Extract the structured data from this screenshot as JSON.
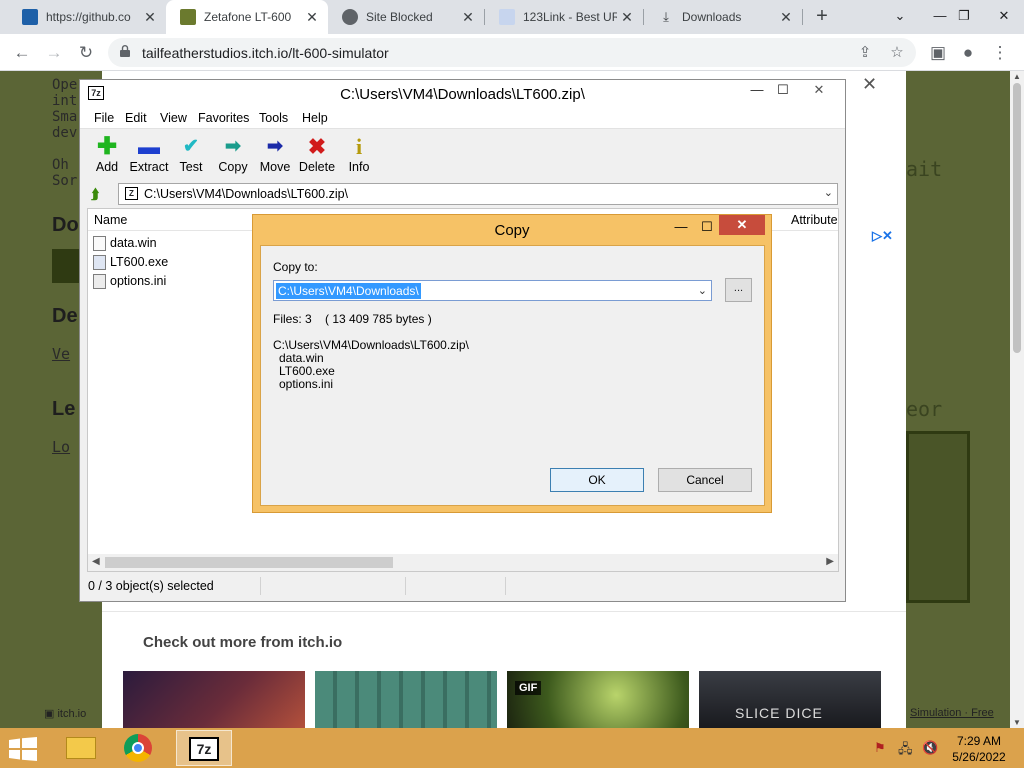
{
  "browser": {
    "tabs": [
      {
        "title": "https://github.co",
        "icon": "github-icon",
        "active": false
      },
      {
        "title": "Zetafone LT-600",
        "icon": "itch-game-icon",
        "active": true
      },
      {
        "title": "Site Blocked",
        "icon": "globe-icon",
        "active": false
      },
      {
        "title": "123Link - Best UR",
        "icon": "link-icon",
        "active": false
      },
      {
        "title": "Downloads",
        "icon": "download-icon",
        "active": false
      }
    ],
    "address": "tailfeatherstudios.itch.io/lt-600-simulator"
  },
  "page": {
    "more_title": "Check out more from itch.io",
    "gif_badge": "GIF",
    "slice_dice": "SLICE DICE",
    "footer_right": "Simulation · Free"
  },
  "zip": {
    "title": "C:\\Users\\VM4\\Downloads\\LT600.zip\\",
    "menu": [
      "File",
      "Edit",
      "View",
      "Favorites",
      "Tools",
      "Help"
    ],
    "tools": [
      {
        "label": "Add",
        "icon": "add-plus-icon",
        "color": "#1fb51f"
      },
      {
        "label": "Extract",
        "icon": "extract-minus-icon",
        "color": "#1d3fcf"
      },
      {
        "label": "Test",
        "icon": "test-check-icon",
        "color": "#21b9c4"
      },
      {
        "label": "Copy",
        "icon": "copy-arrow-icon",
        "color": "#1a9c8c"
      },
      {
        "label": "Move",
        "icon": "move-arrow-icon",
        "color": "#1b2aa8"
      },
      {
        "label": "Delete",
        "icon": "delete-x-icon",
        "color": "#d11b1b"
      },
      {
        "label": "Info",
        "icon": "info-icon",
        "color": "#b59a0c"
      }
    ],
    "address": "C:\\Users\\VM4\\Downloads\\LT600.zip\\",
    "columns": {
      "name": "Name",
      "attributes": "Attribute"
    },
    "files": [
      "data.win",
      "LT600.exe",
      "options.ini"
    ],
    "status": "0 / 3 object(s) selected"
  },
  "copy_dialog": {
    "title": "Copy",
    "copy_to_label": "Copy to:",
    "destination": "C:\\Users\\VM4\\Downloads\\",
    "browse_label": "...",
    "files_info": "Files: 3    ( 13 409 785 bytes )",
    "source_path": "C:\\Users\\VM4\\Downloads\\LT600.zip\\",
    "source_files": [
      "data.win",
      "LT600.exe",
      "options.ini"
    ],
    "ok": "OK",
    "cancel": "Cancel"
  },
  "taskbar": {
    "time": "7:29 AM",
    "date": "5/26/2022",
    "zip_label": "7z"
  }
}
